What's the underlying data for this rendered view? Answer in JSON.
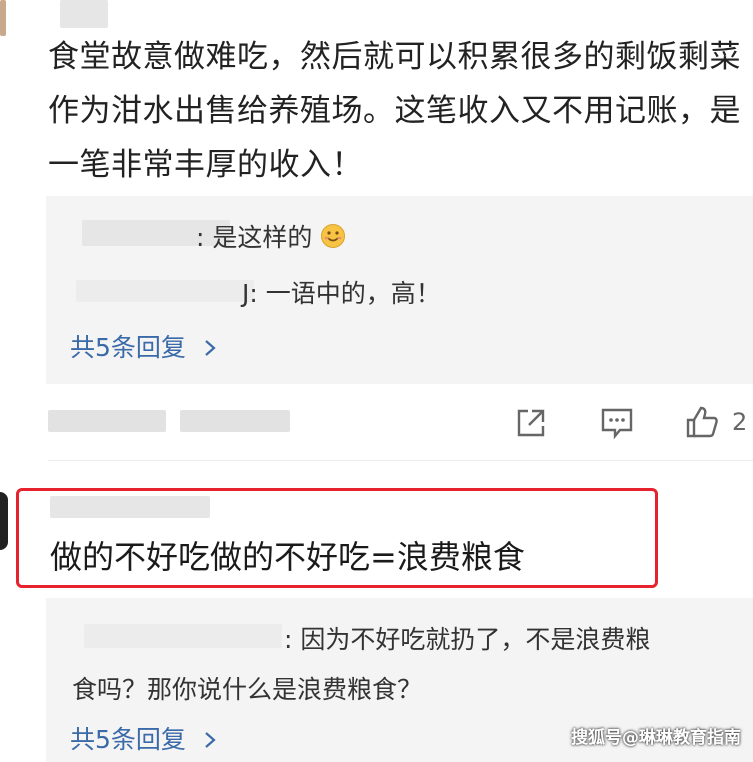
{
  "comment1": {
    "text": "食堂故意做难吃，然后就可以积累很多的剩饭剩菜作为泔水出售给养殖场。这笔收入又不用记账，是一笔非常丰厚的收入！",
    "replies": [
      {
        "text": ": 是这样的"
      },
      {
        "text": "J: 一语中的，高！"
      }
    ],
    "more_label": "共5条回复",
    "like_count": "2"
  },
  "comment2": {
    "text": "做的不好吃做的不好吃=浪费粮食",
    "reply_line1": ": 因为不好吃就扔了，不是浪费粮",
    "reply_line2": "食吗？那你说什么是浪费粮食？",
    "more_label": "共5条回复"
  },
  "watermark": "搜狐号@琳琳教育指南",
  "colors": {
    "link": "#3b6aa8",
    "highlight_border": "#e5222d",
    "reply_bg": "#f4f4f4"
  },
  "icons": [
    "share-icon",
    "comment-icon",
    "like-icon",
    "chevron-right-icon",
    "smile-emoji-icon"
  ]
}
